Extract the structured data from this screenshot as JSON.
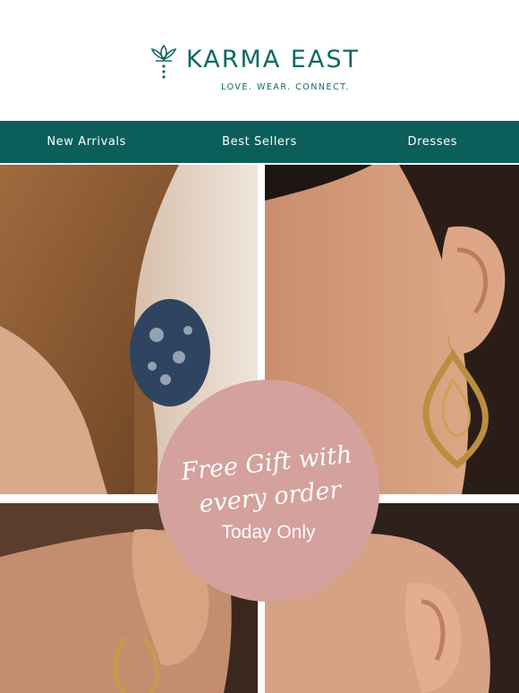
{
  "header": {
    "brand": "KARMA EAST",
    "tagline": "LOVE. WEAR. CONNECT.",
    "logo_icon": "lotus-icon",
    "brand_color": "#0d6a63"
  },
  "nav": {
    "background": "#0b5e5a",
    "items": [
      {
        "label": "New Arrivals"
      },
      {
        "label": "Best Sellers"
      },
      {
        "label": "Dresses"
      }
    ]
  },
  "promo": {
    "headline_line1": "Free Gift with",
    "headline_line2": "every order",
    "subtext": "Today Only",
    "badge_color": "#d4a19c"
  },
  "photos": [
    {
      "subject": "scrunchie-photo"
    },
    {
      "subject": "teardrop-earring-photo"
    },
    {
      "subject": "hoop-earring-photo"
    },
    {
      "subject": "ear-photo"
    }
  ]
}
